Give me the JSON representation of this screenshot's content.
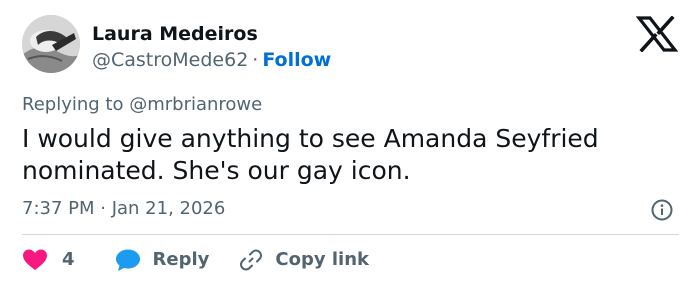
{
  "author": {
    "name": "Laura Medeiros",
    "handle": "@CastroMede62",
    "separator": "·",
    "follow_label": "Follow"
  },
  "reply_context": {
    "prefix": "Replying to",
    "mention": "@mrbrianrowe"
  },
  "tweet": {
    "text": "I would give anything to see Amanda Seyfried nominated. She's our gay icon.",
    "timestamp": "7:37 PM · Jan 21, 2026"
  },
  "actions": {
    "like_count": "4",
    "reply_label": "Reply",
    "copy_link_label": "Copy link"
  },
  "icons": {
    "brand": "x-logo-icon",
    "info": "info-icon",
    "like": "heart-icon",
    "reply": "speech-bubble-icon",
    "copy": "link-icon"
  },
  "colors": {
    "text_primary": "#0f1419",
    "text_secondary": "#536471",
    "link_blue": "#006fd6",
    "like_pink": "#f91880",
    "reply_blue": "#1d9bf0",
    "divider": "#cfd9de"
  }
}
